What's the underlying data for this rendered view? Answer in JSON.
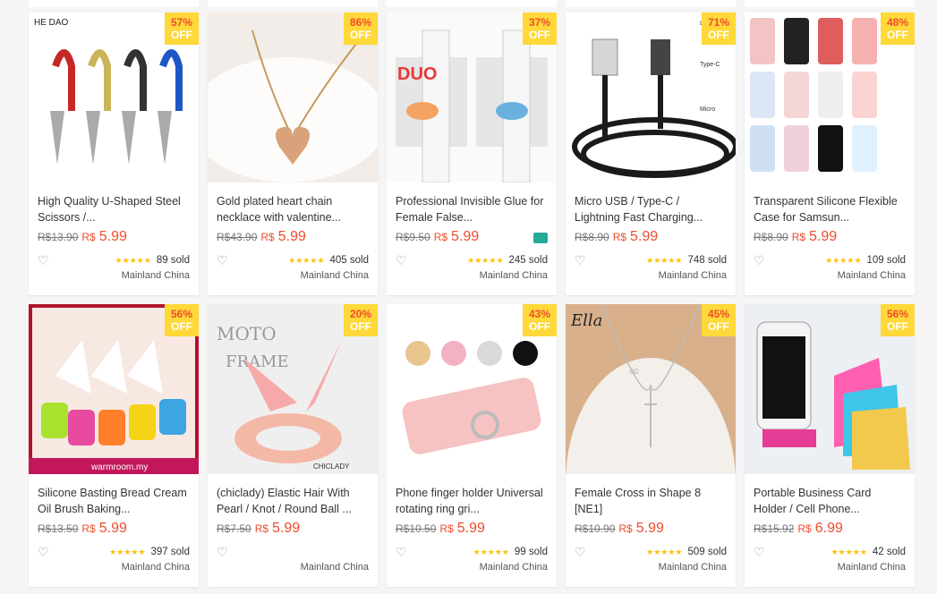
{
  "currency": "R$",
  "discount_suffix": "OFF",
  "products": [
    {
      "discount": "57%",
      "title": "High Quality U-Shaped Steel Scissors /...",
      "old_price": "R$13.90",
      "price": "5.99",
      "sold": "89 sold",
      "location": "Mainland China",
      "rating": "★★★★★",
      "image": "scissors",
      "overlay_text": "HE DAO",
      "tag": false
    },
    {
      "discount": "86%",
      "title": "Gold plated heart chain necklace with valentine...",
      "old_price": "R$43.90",
      "price": "5.99",
      "sold": "405 sold",
      "location": "Mainland China",
      "rating": "★★★★★",
      "image": "heart-necklace",
      "overlay_text": "",
      "tag": false
    },
    {
      "discount": "37%",
      "title": "Professional Invisible Glue for Female False...",
      "old_price": "R$9.50",
      "price": "5.99",
      "sold": "245 sold",
      "location": "Mainland China",
      "rating": "★★★★★",
      "image": "glue",
      "overlay_text": "DUO",
      "tag": true
    },
    {
      "discount": "71%",
      "title": "Micro USB / Type-C / Lightning Fast Charging...",
      "old_price": "R$8.90",
      "price": "5.99",
      "sold": "748 sold",
      "location": "Mainland China",
      "rating": "★★★★★",
      "image": "cable",
      "overlay_text": "Lightning|Type-C|Micro",
      "tag": false
    },
    {
      "discount": "48%",
      "title": "Transparent Silicone Flexible Case for Samsun...",
      "old_price": "R$8.90",
      "price": "5.99",
      "sold": "109 sold",
      "location": "Mainland China",
      "rating": "★★★★★",
      "image": "phone-cases",
      "overlay_text": "",
      "tag": false
    },
    {
      "discount": "56%",
      "title": "Silicone Basting Bread Cream Oil Brush Baking...",
      "old_price": "R$13.50",
      "price": "5.99",
      "sold": "397 sold",
      "location": "Mainland China",
      "rating": "★★★★★",
      "image": "brushes",
      "overlay_text": "warmroom.my",
      "tag": false
    },
    {
      "discount": "20%",
      "title": "(chiclady) Elastic Hair With Pearl / Knot / Round Ball ...",
      "old_price": "R$7.50",
      "price": "5.99",
      "sold": "",
      "location": "Mainland China",
      "rating": "",
      "image": "scrunchie",
      "overlay_text": "CHICLADY",
      "tag": false
    },
    {
      "discount": "43%",
      "title": "Phone finger holder Universal rotating ring gri...",
      "old_price": "R$10.50",
      "price": "5.99",
      "sold": "99 sold",
      "location": "Mainland China",
      "rating": "★★★★★",
      "image": "ring-holder",
      "overlay_text": "",
      "tag": false
    },
    {
      "discount": "45%",
      "title": "Female Cross in Shape 8 [NE1]",
      "old_price": "R$10.90",
      "price": "5.99",
      "sold": "509 sold",
      "location": "Mainland China",
      "rating": "★★★★★",
      "image": "cross-necklace",
      "overlay_text": "Ella",
      "tag": false
    },
    {
      "discount": "56%",
      "title": "Portable Business Card Holder / Cell Phone...",
      "old_price": "R$15.92",
      "price": "6.99",
      "sold": "42 sold",
      "location": "Mainland China",
      "rating": "★★★★★",
      "image": "phone-stand",
      "overlay_text": "",
      "tag": false
    }
  ]
}
